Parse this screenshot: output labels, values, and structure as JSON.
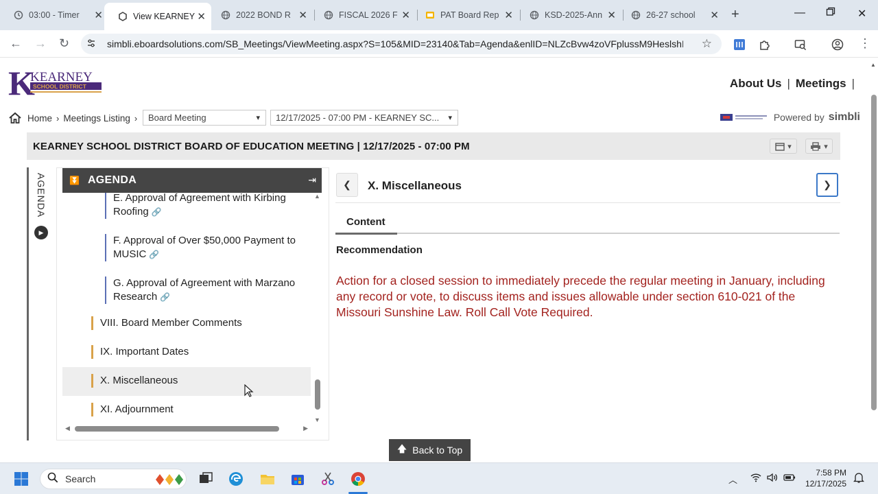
{
  "browser": {
    "tabs": [
      {
        "title": "03:00 - Timer",
        "icon": "clock-icon"
      },
      {
        "title": "View KEARNEY",
        "icon": "simbli-icon",
        "active": true
      },
      {
        "title": "2022 BOND R",
        "icon": "globe-icon"
      },
      {
        "title": "FISCAL 2026 F",
        "icon": "globe-icon"
      },
      {
        "title": "PAT Board Rep",
        "icon": "slides-icon"
      },
      {
        "title": "KSD-2025-Ann",
        "icon": "globe-icon"
      },
      {
        "title": "26-27 school",
        "icon": "globe-icon"
      }
    ],
    "url": "simbli.eboardsolutions.com/SB_Meetings/ViewMeeting.aspx?S=105&MID=23140&Tab=Agenda&enlID=NLZcBvw4zoVFplussM9HeslshI..."
  },
  "site": {
    "logo_name": "KEARNEY",
    "logo_sub": "SCHOOL DISTRICT",
    "nav": [
      "About Us",
      "Meetings"
    ],
    "nav_sep": "|"
  },
  "breadcrumb": {
    "home": "Home",
    "listing": "Meetings Listing",
    "meeting_type": "Board Meeting",
    "meeting_select": "12/17/2025 - 07:00 PM - KEARNEY SC..."
  },
  "powered": {
    "label": "Powered by",
    "brand": "simbli"
  },
  "meeting_title": "KEARNEY SCHOOL DISTRICT BOARD OF EDUCATION MEETING | 12/17/2025 - 07:00 PM",
  "agenda": {
    "vertical_label": "AGENDA",
    "header": "AGENDA",
    "items": [
      {
        "label": "E. Approval of Agreement with Kirbing Roofing",
        "level": "sub"
      },
      {
        "label": "F. Approval of Over $50,000 Payment to MUSIC",
        "level": "sub"
      },
      {
        "label": "G. Approval of Agreement with Marzano Research",
        "level": "sub"
      },
      {
        "label": "VIII. Board Member Comments",
        "level": "top"
      },
      {
        "label": "IX. Important Dates",
        "level": "top"
      },
      {
        "label": "X. Miscellaneous",
        "level": "top",
        "selected": true
      },
      {
        "label": "XI. Adjournment",
        "level": "top"
      }
    ]
  },
  "content": {
    "section_title": "X. Miscellaneous",
    "tab": "Content",
    "heading": "Recommendation",
    "body": "Action for a closed session to immediately precede the regular meeting in January, including any record or vote, to discuss items and issues allowable under section 610-021 of the Missouri Sunshine Law.  Roll Call Vote Required.",
    "body_color": "#a3231f"
  },
  "back_to_top": "Back to Top",
  "taskbar": {
    "search_placeholder": "Search",
    "time": "7:58 PM",
    "date": "12/17/2025"
  }
}
